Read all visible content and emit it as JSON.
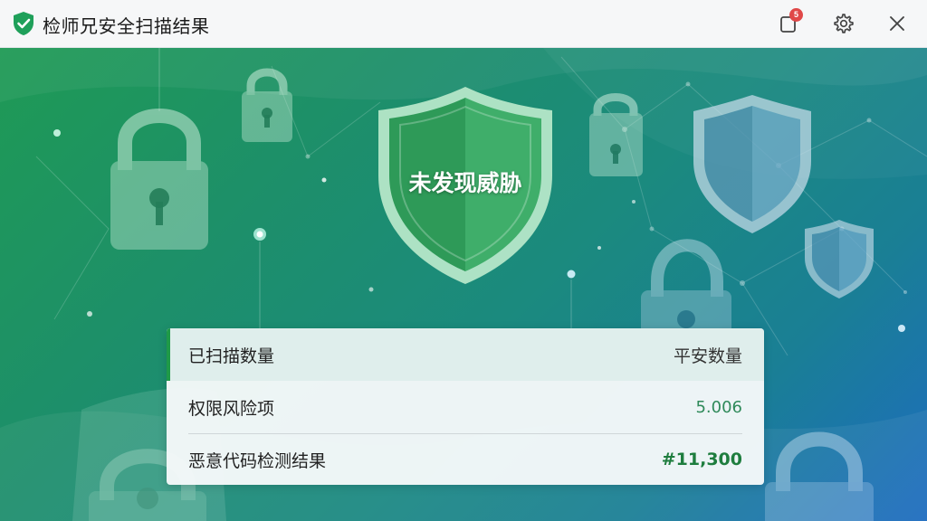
{
  "window": {
    "title": "检师兄安全扫描结果"
  },
  "titlebar": {
    "notification_badge": "5"
  },
  "hero": {
    "status_text": "未发现威胁"
  },
  "results": [
    {
      "label": "已扫描数量",
      "value": "平安数量"
    },
    {
      "label": "权限风险项",
      "value": "5.006"
    },
    {
      "label": "恶意代码检测结果",
      "value": "#11,300"
    }
  ],
  "icons": {
    "app": "shield-check-icon",
    "notification": "notification-icon",
    "settings": "gear-icon",
    "close": "close-icon"
  },
  "colors": {
    "accent_green": "#1f9a48",
    "hero_gradient_start": "#1f9a55",
    "hero_gradient_end": "#1d6cc0",
    "badge_red": "#e04848"
  }
}
